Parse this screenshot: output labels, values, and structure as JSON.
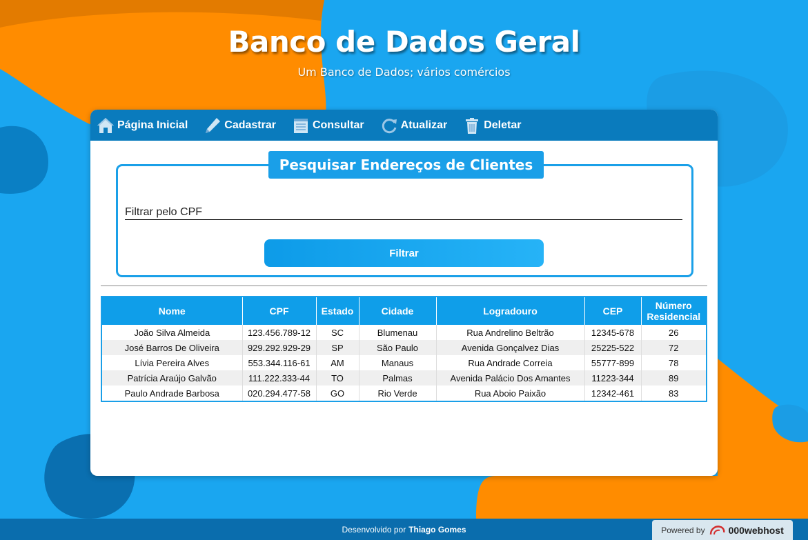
{
  "header": {
    "title": "Banco de Dados Geral",
    "subtitle": "Um Banco de Dados; vários comércios"
  },
  "nav": {
    "items": [
      {
        "label": "Página Inicial",
        "icon": "home-icon"
      },
      {
        "label": "Cadastrar",
        "icon": "pencil-icon"
      },
      {
        "label": "Consultar",
        "icon": "notepad-icon"
      },
      {
        "label": "Atualizar",
        "icon": "refresh-icon"
      },
      {
        "label": "Deletar",
        "icon": "trash-icon"
      }
    ]
  },
  "search": {
    "title": "Pesquisar Endereços de Clientes",
    "placeholder": "Filtrar pelo CPF",
    "button_label": "Filtrar"
  },
  "table": {
    "headers": [
      "Nome",
      "CPF",
      "Estado",
      "Cidade",
      "Logradouro",
      "CEP",
      "Número Residencial"
    ],
    "rows": [
      [
        "João Silva Almeida",
        "123.456.789-12",
        "SC",
        "Blumenau",
        "Rua Andrelino Beltrão",
        "12345-678",
        "26"
      ],
      [
        "José Barros De Oliveira",
        "929.292.929-29",
        "SP",
        "São Paulo",
        "Avenida Gonçalvez Dias",
        "25225-522",
        "72"
      ],
      [
        "Lívia Pereira Alves",
        "553.344.116-61",
        "AM",
        "Manaus",
        "Rua Andrade Correia",
        "55777-899",
        "78"
      ],
      [
        "Patrícia Araújo Galvão",
        "111.222.333-44",
        "TO",
        "Palmas",
        "Avenida Palácio Dos Amantes",
        "11223-344",
        "89"
      ],
      [
        "Paulo Andrade Barbosa",
        "020.294.477-58",
        "GO",
        "Rio Verde",
        "Rua Aboio Paixão",
        "12342-461",
        "83"
      ]
    ]
  },
  "footer": {
    "prefix": "Desenvolvido por",
    "author": "Thiago Gomes",
    "powered_prefix": "Powered by",
    "powered_brand": "000webhost"
  },
  "colors": {
    "background": "#1aa6f0",
    "accent_orange": "#ff8c00",
    "nav": "#0a7bbd",
    "table_header": "#0f9ee9"
  }
}
